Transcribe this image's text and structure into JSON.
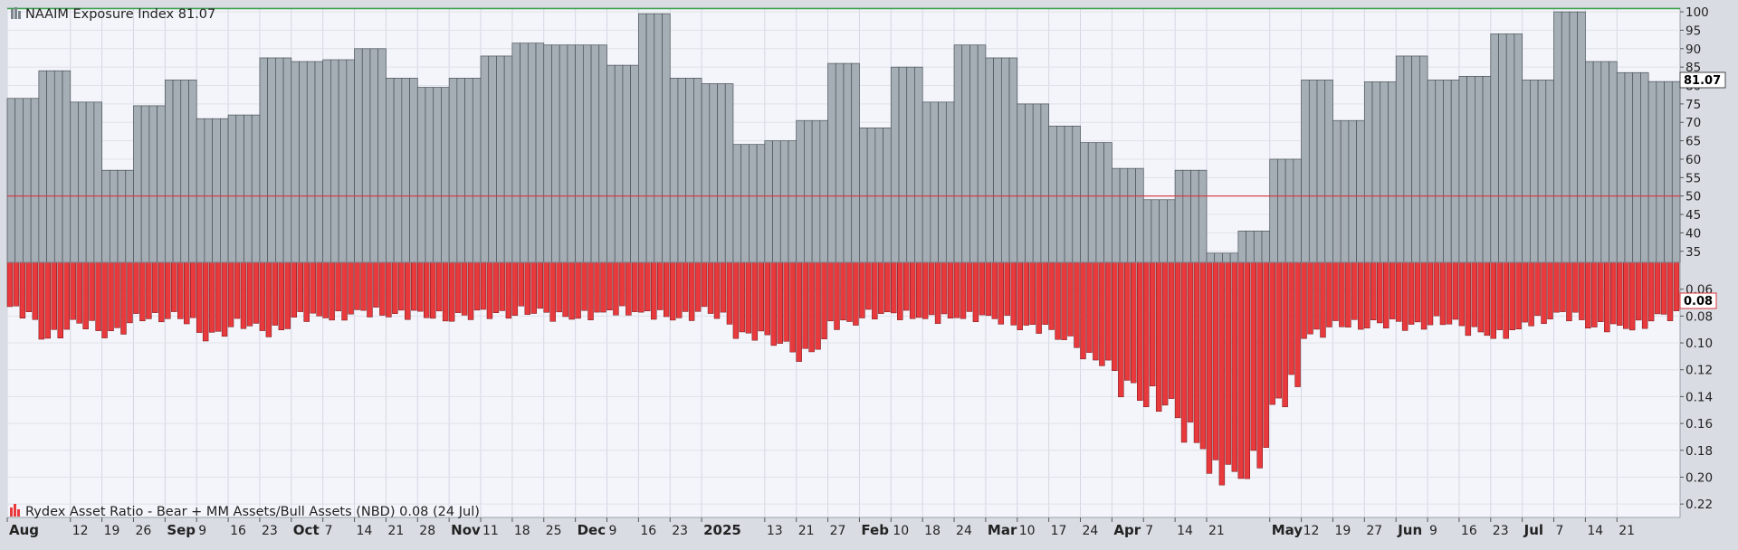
{
  "chart_data": [
    {
      "type": "bar",
      "panel": "top",
      "legend_text": "NAAIM Exposure Index 81.07",
      "last_value_label": "81.07",
      "ylim": [
        32,
        101
      ],
      "y_ticks": [
        "100",
        "95",
        "90",
        "85",
        "80",
        "75",
        "70",
        "65",
        "60",
        "55",
        "50",
        "45",
        "40",
        "35"
      ],
      "reference_line": 50,
      "colors": {
        "bar_fill": "#a5aeb5",
        "bar_stroke": "#4a5259",
        "reference_line": "#d9343a",
        "top_line": "#39a34a"
      },
      "weekly_values": [
        76.5,
        84,
        75.5,
        57,
        74.5,
        81.5,
        71,
        72,
        87.5,
        86.5,
        87,
        90,
        82,
        79.5,
        82,
        88,
        91.5,
        91,
        91,
        85.5,
        99.5,
        82,
        80.5,
        64,
        65,
        70.5,
        86,
        68.5,
        85,
        75.5,
        91,
        87.5,
        75,
        69,
        64.5,
        57.5,
        49,
        57,
        34.5,
        40.5,
        60,
        81.5,
        70.5,
        81,
        88,
        81.5,
        82.5,
        94,
        81.5,
        100,
        86.5,
        83.5,
        81.07
      ]
    },
    {
      "type": "bar",
      "panel": "bottom",
      "legend_text": "Rydex Asset Ratio - Bear + MM Assets/Bull Assets (NBD) 0.08 (24 Jul)",
      "last_value_label": "0.08",
      "ylim": [
        0.04,
        0.23
      ],
      "y_ticks": [
        "0.06",
        "0.08",
        "0.10",
        "0.12",
        "0.14",
        "0.16",
        "0.18",
        "0.20",
        "0.22"
      ],
      "colors": {
        "bar_fill": "#e8393d",
        "bar_stroke": "#6e1215"
      },
      "weekly_values": [
        0.073,
        0.096,
        0.085,
        0.093,
        0.082,
        0.078,
        0.096,
        0.085,
        0.093,
        0.08,
        0.081,
        0.077,
        0.078,
        0.08,
        0.08,
        0.079,
        0.076,
        0.08,
        0.08,
        0.076,
        0.078,
        0.081,
        0.076,
        0.093,
        0.098,
        0.11,
        0.087,
        0.079,
        0.079,
        0.082,
        0.08,
        0.082,
        0.087,
        0.094,
        0.108,
        0.13,
        0.14,
        0.161,
        0.195,
        0.2,
        0.15,
        0.094,
        0.087,
        0.085,
        0.088,
        0.083,
        0.09,
        0.095,
        0.085,
        0.078,
        0.087,
        0.09,
        0.08
      ]
    }
  ],
  "x_axis": {
    "labels": [
      {
        "text": "Aug",
        "w": 0,
        "bold": true
      },
      {
        "text": "12",
        "w": 2,
        "bold": false
      },
      {
        "text": "19",
        "w": 3,
        "bold": false
      },
      {
        "text": "26",
        "w": 4,
        "bold": false
      },
      {
        "text": "Sep",
        "w": 5,
        "bold": true
      },
      {
        "text": "9",
        "w": 6,
        "bold": false
      },
      {
        "text": "16",
        "w": 7,
        "bold": false
      },
      {
        "text": "23",
        "w": 8,
        "bold": false
      },
      {
        "text": "Oct",
        "w": 9,
        "bold": true
      },
      {
        "text": "7",
        "w": 10,
        "bold": false
      },
      {
        "text": "14",
        "w": 11,
        "bold": false
      },
      {
        "text": "21",
        "w": 12,
        "bold": false
      },
      {
        "text": "28",
        "w": 13,
        "bold": false
      },
      {
        "text": "Nov",
        "w": 14,
        "bold": true
      },
      {
        "text": "11",
        "w": 15,
        "bold": false
      },
      {
        "text": "18",
        "w": 16,
        "bold": false
      },
      {
        "text": "25",
        "w": 17,
        "bold": false
      },
      {
        "text": "Dec",
        "w": 18,
        "bold": true
      },
      {
        "text": "9",
        "w": 19,
        "bold": false
      },
      {
        "text": "16",
        "w": 20,
        "bold": false
      },
      {
        "text": "23",
        "w": 21,
        "bold": false
      },
      {
        "text": "2025",
        "w": 22,
        "bold": true
      },
      {
        "text": "13",
        "w": 24,
        "bold": false
      },
      {
        "text": "21",
        "w": 25,
        "bold": false
      },
      {
        "text": "27",
        "w": 26,
        "bold": false
      },
      {
        "text": "Feb",
        "w": 27,
        "bold": true
      },
      {
        "text": "10",
        "w": 28,
        "bold": false
      },
      {
        "text": "18",
        "w": 29,
        "bold": false
      },
      {
        "text": "24",
        "w": 30,
        "bold": false
      },
      {
        "text": "Mar",
        "w": 31,
        "bold": true
      },
      {
        "text": "10",
        "w": 32,
        "bold": false
      },
      {
        "text": "17",
        "w": 33,
        "bold": false
      },
      {
        "text": "24",
        "w": 34,
        "bold": false
      },
      {
        "text": "Apr",
        "w": 35,
        "bold": true
      },
      {
        "text": "7",
        "w": 36,
        "bold": false
      },
      {
        "text": "14",
        "w": 37,
        "bold": false
      },
      {
        "text": "21",
        "w": 38,
        "bold": false
      },
      {
        "text": "May",
        "w": 40,
        "bold": true
      },
      {
        "text": "12",
        "w": 41,
        "bold": false
      },
      {
        "text": "19",
        "w": 42,
        "bold": false
      },
      {
        "text": "27",
        "w": 43,
        "bold": false
      },
      {
        "text": "Jun",
        "w": 44,
        "bold": true
      },
      {
        "text": "9",
        "w": 45,
        "bold": false
      },
      {
        "text": "16",
        "w": 46,
        "bold": false
      },
      {
        "text": "23",
        "w": 47,
        "bold": false
      },
      {
        "text": "Jul",
        "w": 48,
        "bold": true
      },
      {
        "text": "7",
        "w": 49,
        "bold": false
      },
      {
        "text": "14",
        "w": 50,
        "bold": false
      },
      {
        "text": "21",
        "w": 51,
        "bold": false
      }
    ]
  }
}
